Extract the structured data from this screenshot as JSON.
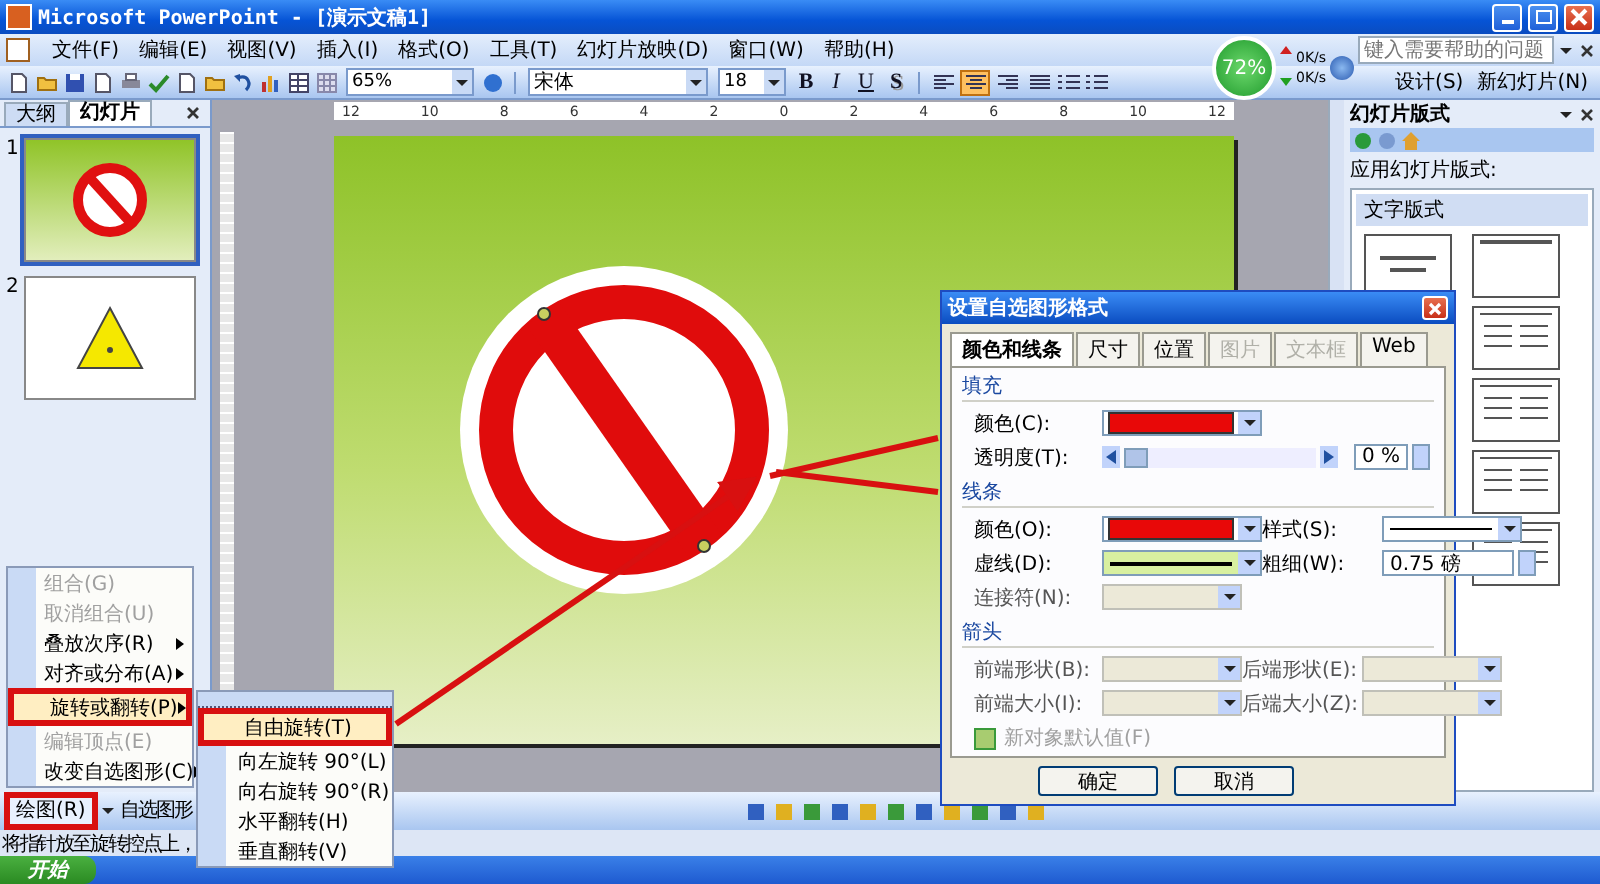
{
  "window": {
    "title": "Microsoft PowerPoint - [演示文稿1]"
  },
  "menu_bar": {
    "items": [
      "文件(F)",
      "编辑(E)",
      "视图(V)",
      "插入(I)",
      "格式(O)",
      "工具(T)",
      "幻灯片放映(D)",
      "窗口(W)",
      "帮助(H)"
    ],
    "help_placeholder": "键入需要帮助的问题"
  },
  "toolbar": {
    "zoom": "65%",
    "font": "宋体",
    "font_size": "18",
    "format_buttons": [
      {
        "label": "B",
        "kind": "bold"
      },
      {
        "label": "I",
        "kind": "italic"
      },
      {
        "label": "U",
        "kind": "underline"
      },
      {
        "label": "S",
        "kind": "shadow"
      }
    ],
    "align_buttons": [
      {
        "kind": "left",
        "selected": false
      },
      {
        "kind": "center",
        "selected": true
      },
      {
        "kind": "right",
        "selected": false
      },
      {
        "kind": "justify",
        "selected": false
      }
    ],
    "right_buttons": [
      "设计(S)",
      "新幻灯片(N)"
    ]
  },
  "speed_widget": {
    "percent": "72%",
    "upload": "0K/s",
    "download": "0K/s"
  },
  "left_pane": {
    "tabs": [
      {
        "label": "大纲",
        "selected": false
      },
      {
        "label": "幻灯片",
        "selected": true
      }
    ],
    "slides": [
      {
        "number": "1",
        "kind": "prohibition",
        "selected": true
      },
      {
        "number": "2",
        "kind": "triangle",
        "selected": false
      }
    ]
  },
  "ruler": [
    "12",
    "10",
    "8",
    "6",
    "4",
    "2",
    "0",
    "2",
    "4",
    "6",
    "8",
    "10",
    "12"
  ],
  "task_pane": {
    "title": "幻灯片版式",
    "apply_label": "应用幻灯片版式:",
    "section": "文字版式"
  },
  "dialog": {
    "title": "设置自选图形格式",
    "tabs": [
      {
        "label": "颜色和线条",
        "selected": true,
        "disabled": false
      },
      {
        "label": "尺寸",
        "selected": false,
        "disabled": false
      },
      {
        "label": "位置",
        "selected": false,
        "disabled": false
      },
      {
        "label": "图片",
        "selected": false,
        "disabled": true
      },
      {
        "label": "文本框",
        "selected": false,
        "disabled": true
      },
      {
        "label": "Web",
        "selected": false,
        "disabled": false
      }
    ],
    "sections": [
      {
        "title": "填充",
        "rows": [
          [
            {
              "label": "颜色(C):",
              "kind": "color",
              "color": "#e80808",
              "disabled": false
            }
          ],
          [
            {
              "label": "透明度(T):",
              "kind": "slider",
              "level": 0,
              "value": "0 %",
              "disabled": false
            }
          ]
        ]
      },
      {
        "title": "线条",
        "rows": [
          [
            {
              "label": "颜色(O):",
              "kind": "color",
              "color": "#e80808",
              "disabled": false
            },
            {
              "label": "样式(S):",
              "kind": "line-style",
              "disabled": false
            }
          ],
          [
            {
              "label": "虚线(D):",
              "kind": "dash",
              "disabled": false
            },
            {
              "label": "粗细(W):",
              "kind": "spinner",
              "value": "0.75 磅",
              "disabled": false
            }
          ],
          [
            {
              "label": "连接符(N):",
              "kind": "dropdown",
              "disabled": true
            }
          ]
        ]
      },
      {
        "title": "箭头",
        "rows": [
          [
            {
              "label": "前端形状(B):",
              "kind": "dropdown",
              "disabled": true
            },
            {
              "label": "后端形状(E):",
              "kind": "dropdown",
              "disabled": true
            }
          ],
          [
            {
              "label": "前端大小(I):",
              "kind": "dropdown",
              "disabled": true
            },
            {
              "label": "后端大小(Z):",
              "kind": "dropdown",
              "disabled": true
            }
          ]
        ]
      }
    ],
    "checkbox": {
      "label": "新对象默认值(F)",
      "checked": false,
      "disabled": true
    },
    "buttons": [
      "确定",
      "取消"
    ]
  },
  "context_menu": {
    "items": [
      {
        "label": "组合(G)",
        "disabled": true,
        "submenu": false,
        "selected": false,
        "marked": false
      },
      {
        "label": "取消组合(U)",
        "disabled": true,
        "submenu": false,
        "selected": false,
        "marked": false
      },
      {
        "label": "叠放次序(R)",
        "disabled": false,
        "submenu": true,
        "selected": false,
        "marked": false
      },
      {
        "label": "对齐或分布(A)",
        "disabled": false,
        "submenu": true,
        "selected": false,
        "marked": false
      },
      {
        "label": "旋转或翻转(P)",
        "disabled": false,
        "submenu": true,
        "selected": true,
        "marked": true
      },
      {
        "label": "编辑顶点(E)",
        "disabled": true,
        "submenu": false,
        "selected": false,
        "marked": false
      },
      {
        "label": "改变自选图形(C)",
        "disabled": false,
        "submenu": true,
        "selected": false,
        "marked": false
      }
    ]
  },
  "submenu": {
    "items": [
      {
        "label": "自由旋转(T)",
        "selected": true,
        "marked": true
      },
      {
        "label": "向左旋转 90°(L)",
        "selected": false,
        "marked": false
      },
      {
        "label": "向右旋转 90°(R)",
        "selected": false,
        "marked": false
      },
      {
        "label": "水平翻转(H)",
        "selected": false,
        "marked": false
      },
      {
        "label": "垂直翻转(V)",
        "selected": false,
        "marked": false
      }
    ]
  },
  "drawing_toolbar": {
    "draw_button": {
      "label": "绘图(R)",
      "marked": true
    },
    "autoshapes": "自选图形"
  },
  "status_bar": "将指针放至旋转控点上，",
  "taskbar": {
    "start": "开始"
  }
}
